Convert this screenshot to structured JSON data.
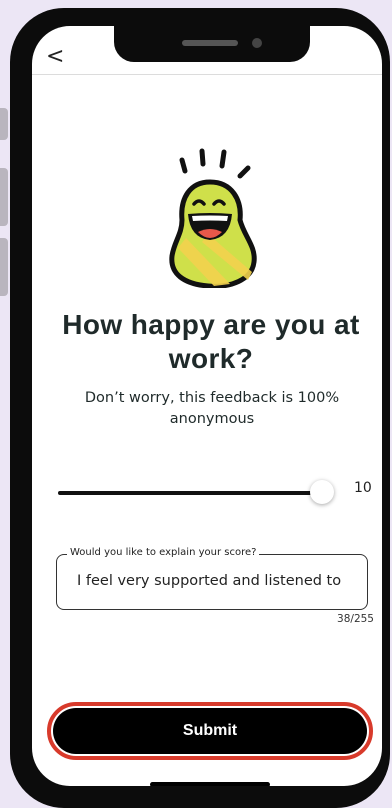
{
  "nav": {
    "back_glyph": "<"
  },
  "mascot": {
    "icon": "laughing-pear-mascot-icon",
    "body_color": "#cfe04a",
    "stripe_color": "#f2d14e"
  },
  "question": {
    "title": "How happy are you at work?",
    "subtitle": "Don’t worry, this feedback is 100% anonymous"
  },
  "slider": {
    "value": "10",
    "min": 0,
    "max": 10
  },
  "explain": {
    "label": "Would you like to explain your score?",
    "value": "I feel very supported and listened to",
    "counter": "38/255"
  },
  "submit": {
    "label": "Submit",
    "highlight_color": "#d83a2b"
  }
}
